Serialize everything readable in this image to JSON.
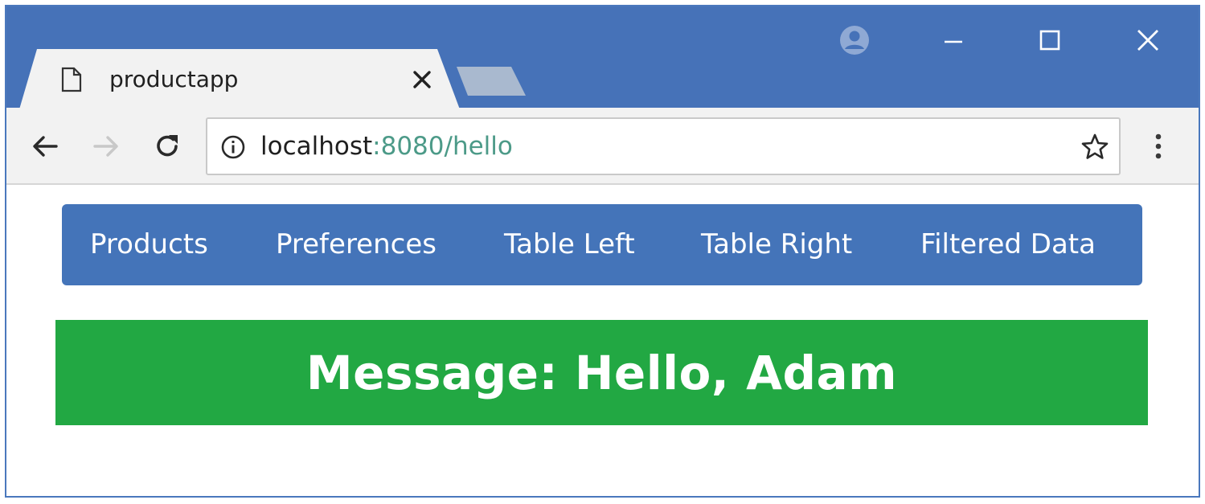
{
  "browser": {
    "tab": {
      "title": "productapp",
      "favicon": "page-icon",
      "close_icon": "close-icon"
    },
    "new_tab_icon": "new-tab-button",
    "window_controls": [
      "profile-icon",
      "minimize-icon",
      "maximize-icon",
      "close-icon"
    ],
    "nav": [
      "back-icon",
      "forward-icon",
      "reload-icon"
    ],
    "address": {
      "host": "localhost",
      "rest": ":8080/hello",
      "info_icon": "info-icon",
      "star_icon": "star-icon"
    },
    "menu_icon": "kebab-menu-icon",
    "colors": {
      "frame": "#4672b8",
      "toolbar": "#f2f2f2",
      "url_dim": "#4c9a88"
    }
  },
  "page": {
    "navbar": {
      "links": [
        "Products",
        "Preferences",
        "Table Left",
        "Table Right",
        "Filtered Data"
      ],
      "color": "#4474b9"
    },
    "alert": {
      "text": "Message: Hello, Adam",
      "color": "#22a843"
    }
  }
}
